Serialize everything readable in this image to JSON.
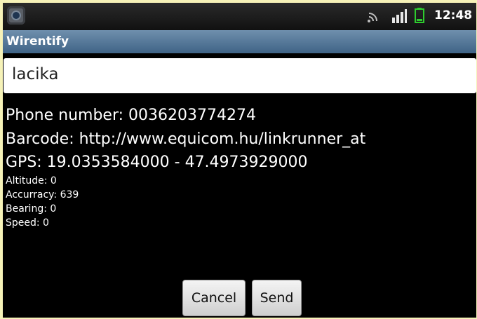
{
  "status_bar": {
    "time": "12:48",
    "icons": [
      "app-notification-icon",
      "wifi-icon",
      "signal-icon",
      "battery-icon"
    ]
  },
  "app": {
    "title": "Wirentify"
  },
  "input": {
    "value": "lacika"
  },
  "details": {
    "phone": "Phone number: 0036203774274",
    "barcode": "Barcode: http://www.equicom.hu/linkrunner_at",
    "gps": "GPS: 19.0353584000 - 47.4973929000",
    "altitude": "Altitude: 0",
    "accuracy": "Accurracy: 639",
    "bearing": "Bearing: 0",
    "speed": "Speed: 0"
  },
  "buttons": {
    "cancel": "Cancel",
    "send": "Send"
  },
  "colors": {
    "title_bar": "#4f7296",
    "background": "#000000",
    "frame": "#f6f2b8",
    "battery": "#2ecc2e"
  }
}
